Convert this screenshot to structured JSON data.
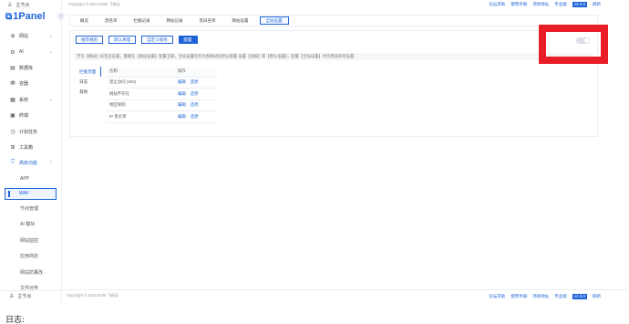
{
  "sidebar": {
    "top_user": "主节点",
    "logo": "1Panel",
    "menu": [
      {
        "icon": "globe-icon",
        "glyph": "⊕",
        "label": "网站",
        "chevron": "⌄"
      },
      {
        "icon": "ai-icon",
        "glyph": "⚙",
        "label": "AI",
        "chevron": "⌄"
      },
      {
        "icon": "database-icon",
        "glyph": "▤",
        "label": "数据库",
        "chevron": ""
      },
      {
        "icon": "container-icon",
        "glyph": "⛃",
        "label": "容器",
        "chevron": ""
      },
      {
        "icon": "system-icon",
        "glyph": "▦",
        "label": "系统",
        "chevron": "⌄"
      },
      {
        "icon": "terminal-icon",
        "glyph": "▣",
        "label": "终端",
        "chevron": ""
      },
      {
        "icon": "schedule-icon",
        "glyph": "◷",
        "label": "计划任务",
        "chevron": ""
      },
      {
        "icon": "toolbox-icon",
        "glyph": "⊞",
        "label": "工具箱",
        "chevron": ""
      },
      {
        "icon": "shield-icon",
        "glyph": "⛉",
        "label": "高级功能",
        "chevron": "⌃"
      }
    ],
    "submenu": [
      "APP",
      "WAF",
      "节点管理",
      "AI 模块",
      "网站监控",
      "应用商店",
      "网站防篡改",
      "文件对传"
    ],
    "bottom_user": "主节点"
  },
  "topbar": {
    "copyright": "Copyright © 2014-2025 飞致云",
    "links": [
      "论坛求助",
      "使用手册",
      "项目地址",
      "专业版"
    ],
    "chip": "v2.0.0",
    "refresh": "刷新"
  },
  "tabs": [
    "概览",
    "黑名单",
    "拦截记录",
    "网站记录",
    "黑白名单",
    "网站设置",
    "全局设置"
  ],
  "actions": [
    "推荐规则",
    "默认清理",
    "自定义规则",
    "配置"
  ],
  "hint": "字号【网站】标签页设置，需要在【网站设置】配置互联，全局设置仅作为各网站的默认配置 设置【海报】和【默认设置】，配置【全局设置】时可用该项目设置",
  "subnav": [
    "拦截页面",
    "日志",
    "其他"
  ],
  "table": {
    "headers": [
      "名称",
      "操作"
    ],
    "rows": [
      {
        "name": "禁止访问 (403)",
        "edit": "编辑",
        "del": "还原"
      },
      {
        "name": "网站不存在",
        "edit": "编辑",
        "del": "还原"
      },
      {
        "name": "地区限制",
        "edit": "编辑",
        "del": "还原"
      },
      {
        "name": "IP 黑名单",
        "edit": "编辑",
        "del": "还原"
      }
    ]
  },
  "bottombar": {
    "copyright": "Copyright © 2014-2025 飞致云",
    "links": [
      "论坛求助",
      "使用手册",
      "项目地址",
      "专业版"
    ],
    "chip": "v2.0.0",
    "refresh": "刷新"
  },
  "log_label": "日志:",
  "colors": {
    "accent": "#1e64d8",
    "highlight": "#e81d28"
  }
}
